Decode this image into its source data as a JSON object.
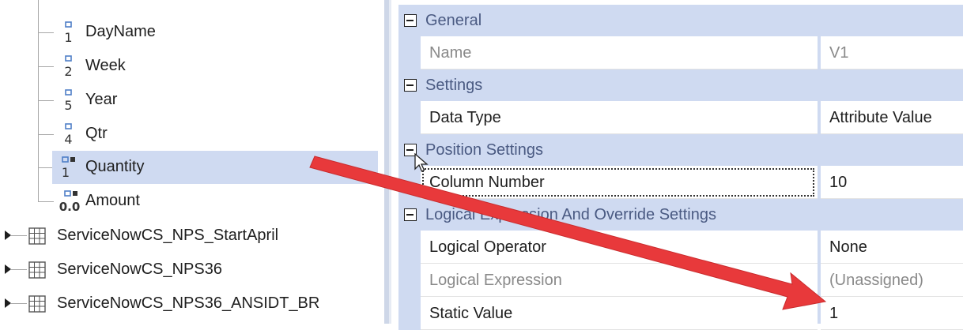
{
  "tree": {
    "fields": [
      {
        "label": "DayName",
        "icon_digit": "1",
        "icon": "integer-field-icon"
      },
      {
        "label": "Week",
        "icon_digit": "2",
        "icon": "integer-field-icon"
      },
      {
        "label": "Year",
        "icon_digit": "5",
        "icon": "integer-field-icon"
      },
      {
        "label": "Qtr",
        "icon_digit": "4",
        "icon": "integer-field-icon"
      },
      {
        "label": "Quantity",
        "icon_digit": "1",
        "icon": "integer-measure-icon",
        "selected": true
      },
      {
        "label": "Amount",
        "icon_digit": "0.0",
        "icon": "decimal-measure-icon"
      }
    ],
    "tables": [
      {
        "label": "ServiceNowCS_NPS_StartApril",
        "icon": "table-icon"
      },
      {
        "label": "ServiceNowCS_NPS36",
        "icon": "table-icon"
      },
      {
        "label": "ServiceNowCS_NPS36_ANSIDT_BR",
        "icon": "table-icon"
      }
    ]
  },
  "grid": {
    "categories": {
      "general": "General",
      "settings": "Settings",
      "position": "Position Settings",
      "logical": "Logical Expression And Override Settings"
    },
    "properties": {
      "name": {
        "label": "Name",
        "value": "V1"
      },
      "data_type": {
        "label": "Data Type",
        "value": "Attribute Value"
      },
      "column_number": {
        "label": "Column Number",
        "value": "10"
      },
      "logical_operator": {
        "label": "Logical Operator",
        "value": "None"
      },
      "logical_expression": {
        "label": "Logical Expression",
        "value": "(Unassigned)"
      },
      "static_value": {
        "label": "Static Value",
        "value": "1"
      }
    }
  },
  "colors": {
    "selection": "#cfdaf1",
    "category_bg": "#cfdaf1",
    "arrow": "#e8393b"
  }
}
